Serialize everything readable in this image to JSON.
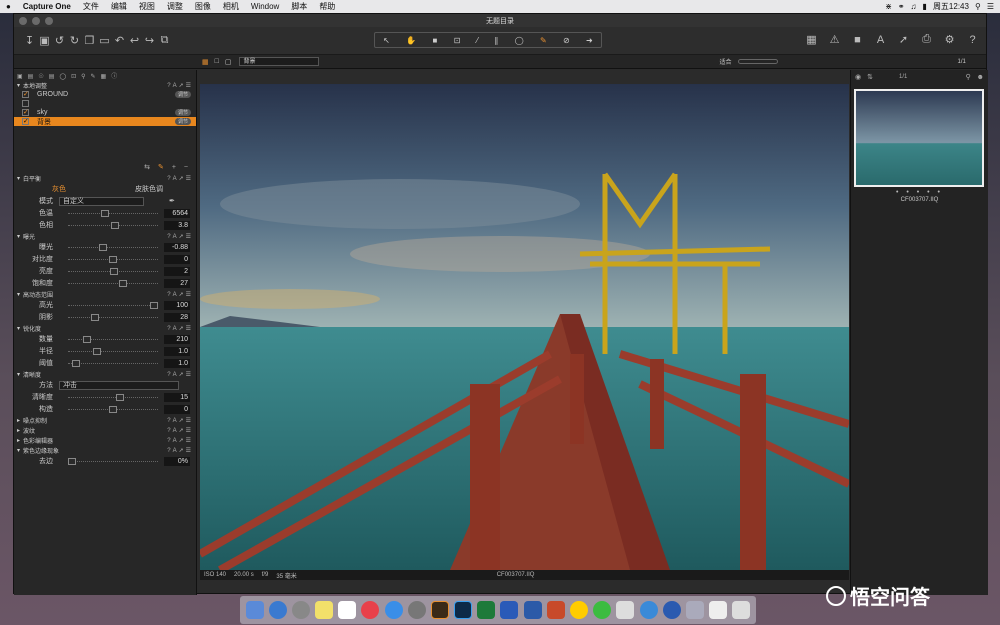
{
  "menubar": {
    "apple": "",
    "app": "Capture One",
    "items": [
      "文件",
      "编辑",
      "视图",
      "调整",
      "图像",
      "相机",
      "Window",
      "脚本",
      "帮助"
    ],
    "clock": "周五12:43"
  },
  "window": {
    "title": "无题目录"
  },
  "subbar": {
    "layer_select": "背景",
    "zoom_label": "适合",
    "page": "1/1"
  },
  "left": {
    "local_header": "本地调整",
    "layers": [
      {
        "name": "GROUND",
        "badge": "调节",
        "checked": true
      },
      {
        "name": "",
        "badge": "",
        "checked": false
      },
      {
        "name": "sky",
        "badge": "调节",
        "checked": true
      },
      {
        "name": "背景",
        "badge": "调节",
        "checked": true,
        "selected": true
      }
    ],
    "wb": {
      "title": "白平衡",
      "tab1": "灰色",
      "tab2": "皮肤色调",
      "mode_label": "模式",
      "mode_value": "自定义",
      "rows": [
        {
          "label": "色温",
          "value": "6564",
          "pos": 0.4
        },
        {
          "label": "色相",
          "value": "3.8",
          "pos": 0.52
        }
      ]
    },
    "exposure": {
      "title": "曝光",
      "rows": [
        {
          "label": "曝光",
          "value": "-0.88",
          "pos": 0.38
        },
        {
          "label": "对比度",
          "value": "0",
          "pos": 0.5
        },
        {
          "label": "亮度",
          "value": "2",
          "pos": 0.51
        },
        {
          "label": "饱和度",
          "value": "27",
          "pos": 0.62
        }
      ]
    },
    "hdr": {
      "title": "高动态范围",
      "rows": [
        {
          "label": "高光",
          "value": "100",
          "pos": 1.0
        },
        {
          "label": "阴影",
          "value": "28",
          "pos": 0.28
        }
      ]
    },
    "sharp": {
      "title": "锐化度",
      "rows": [
        {
          "label": "数量",
          "value": "210",
          "pos": 0.18
        },
        {
          "label": "半径",
          "value": "1.0",
          "pos": 0.3
        },
        {
          "label": "阈值",
          "value": "1.0",
          "pos": 0.05
        }
      ]
    },
    "clarity": {
      "title": "清晰度",
      "method_label": "方法",
      "method_value": "冲击",
      "rows": [
        {
          "label": "清晰度",
          "value": "15",
          "pos": 0.58
        },
        {
          "label": "构造",
          "value": "0",
          "pos": 0.5
        }
      ]
    },
    "collapsed": [
      "噪点抑制",
      "波纹",
      "色彩编辑器"
    ],
    "fringe": {
      "title": "紫色边缘现象",
      "rows": [
        {
          "label": "去边",
          "value": "0%",
          "pos": 0.0
        }
      ]
    }
  },
  "viewer": {
    "iso": "ISO 140",
    "shutter": "20.00 s",
    "aperture": "f/9",
    "focal": "35 毫米",
    "filename": "CF003707.IIQ"
  },
  "right": {
    "thumb_name": "CF003707.IIQ",
    "count": "1/1"
  },
  "watermark": {
    "text": "悟空问答"
  }
}
